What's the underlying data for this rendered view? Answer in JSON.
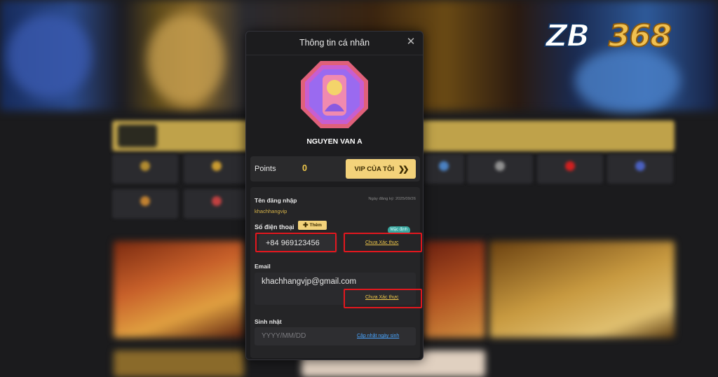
{
  "logo": {
    "zb": "ZB",
    "num": "368"
  },
  "modal": {
    "title": "Thông tin cá nhân",
    "close_icon": "close-icon",
    "username": "NGUYEN VAN A",
    "points_label": "Points",
    "points_value": "0",
    "vip_button": "VIP CỦA TÔI",
    "login_label": "Tên đăng nhập",
    "register_date": "Ngày đăng ký: 2025/09/26",
    "login_value": "khachhangvip",
    "phone_label": "Số điện thoại",
    "add_button": "Thêm",
    "default_badge": "Mặc định",
    "phone_value": "+84 969123456",
    "phone_verify": "Chưa Xác thực",
    "email_label": "Email",
    "email_value": "khachhangvjp@gmail.com",
    "email_verify": "Chưa Xác thực",
    "birthday_label": "Sinh nhật",
    "birthday_placeholder": "YYYY/MM/DD",
    "birthday_update": "Cập nhật ngày sinh"
  },
  "colors": {
    "accent_gold": "#f3d27a",
    "highlight_red": "#e3171e",
    "link_blue": "#4aa6ff",
    "panel_bg": "#1c1c1e"
  }
}
